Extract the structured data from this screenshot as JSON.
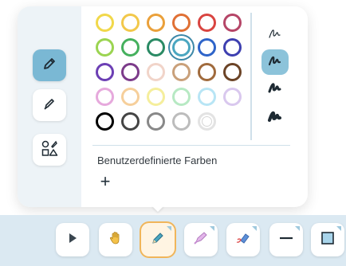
{
  "popover": {
    "custom_colors_label": "Benutzerdefinierte Farben",
    "add_label": "+",
    "tools": [
      {
        "name": "pen",
        "icon": "pen-icon",
        "active": true
      },
      {
        "name": "highlighter",
        "icon": "highlighter-icon",
        "active": false
      },
      {
        "name": "shapes",
        "icon": "shapes-icon",
        "active": false
      }
    ],
    "colors": [
      [
        "#f1d84a",
        "#f2c84a",
        "#eaa03a",
        "#e07034",
        "#d94440",
        "#b54567"
      ],
      [
        "#9bd451",
        "#45b05d",
        "#2a8a64",
        "#4aa6c0",
        "#2e64c9",
        "#3d3fb0"
      ],
      [
        "#6c3fb4",
        "#7c3b8a",
        "#f1d4c9",
        "#c9a07a",
        "#a06a3c",
        "#6b4326"
      ],
      [
        "#e6a9dc",
        "#f6cf9b",
        "#f5ee9c",
        "#b7e9c3",
        "#b8e5f5",
        "#d9c8ee"
      ],
      [
        "#000000",
        "#444444",
        "#888888",
        "#bcbcbc",
        "#e3e3e3"
      ]
    ],
    "selected_color": "#4aa6c0",
    "stroke_sizes": [
      "thin",
      "medium",
      "thick",
      "extra-thick"
    ],
    "active_stroke": "medium"
  },
  "toolbar": {
    "tools": [
      {
        "name": "select",
        "icon": "cursor-icon"
      },
      {
        "name": "hand",
        "icon": "hand-icon"
      },
      {
        "name": "pen",
        "icon": "pen-icon",
        "active": true
      },
      {
        "name": "highlighter",
        "icon": "highlighter-icon"
      },
      {
        "name": "eraser",
        "icon": "eraser-icon"
      },
      {
        "name": "line",
        "icon": "line-icon"
      },
      {
        "name": "rectangle",
        "icon": "rectangle-icon"
      }
    ]
  }
}
